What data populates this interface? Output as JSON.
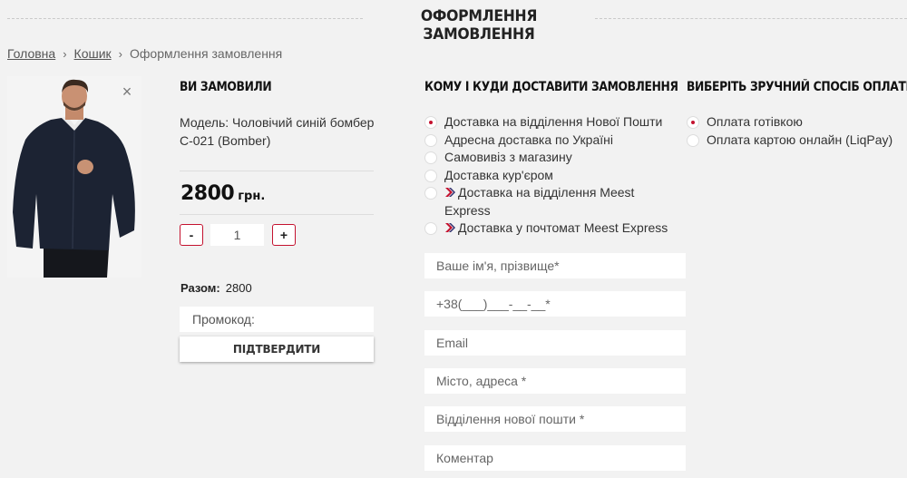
{
  "page": {
    "title": "ОФОРМЛЕННЯ ЗАМОВЛЕННЯ"
  },
  "breadcrumb": {
    "home": "Головна",
    "cart": "Кошик",
    "current": "Оформлення замовлення",
    "separator": "›"
  },
  "order": {
    "heading": "ВИ ЗАМОВИЛИ",
    "remove_symbol": "×",
    "model": "Модель: Чоловічий синій бомбер С-021 (Bomber)",
    "price": "2800",
    "currency": "грн.",
    "minus_label": "-",
    "plus_label": "+",
    "quantity": "1",
    "total_label": "Разом:",
    "total_value": "2800",
    "promo_placeholder": "Промокод:",
    "confirm_label": "ПІДТВЕРДИТИ"
  },
  "delivery": {
    "heading": "КОМУ І КУДИ ДОСТАВИТИ ЗАМОВЛЕННЯ",
    "options": [
      {
        "label": "Доставка на відділення Нової Пошти",
        "checked": true
      },
      {
        "label": "Адресна доставка по Україні",
        "checked": false
      },
      {
        "label": "Самовивіз з магазину",
        "checked": false
      },
      {
        "label": "Доставка кур'єром",
        "checked": false
      },
      {
        "label": "Доставка на відділення Meest Express",
        "checked": false,
        "icon": "meest-icon"
      },
      {
        "label": "Доставка у почтомат Meest Express",
        "checked": false,
        "icon": "meest-icon"
      }
    ],
    "fields": {
      "name": "Ваше ім'я, прізвище*",
      "phone": "+38(___)___-__-__*",
      "email": "Email",
      "city": "Місто, адреса *",
      "branch": "Відділення нової пошти *",
      "comment": "Коментар"
    }
  },
  "payment": {
    "heading": "ВИБЕРІТЬ ЗРУЧНИЙ СПОСІБ ОПЛАТИ",
    "options": [
      {
        "label": "Оплата готівкою",
        "checked": true
      },
      {
        "label": "Оплата картою онлайн (LiqPay)",
        "checked": false
      }
    ]
  },
  "colors": {
    "accent": "#c4122f",
    "background": "#f2f2f2",
    "jacket": "#1c2333"
  }
}
